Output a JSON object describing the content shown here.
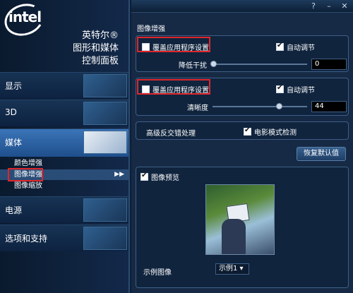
{
  "window": {
    "help_btn": "?",
    "min_btn": "–",
    "close_btn": "✕"
  },
  "brand": {
    "logo": "intel",
    "line1": "英特尔®",
    "line2": "图形和媒体",
    "line3": "控制面板"
  },
  "nav": {
    "display": "显示",
    "threed": "3D",
    "media": "媒体",
    "media_sub": [
      "颜色增强",
      "图像增强",
      "图像缩放"
    ],
    "power": "电源",
    "options": "选项和支持",
    "submenu_arrow": "▶▶"
  },
  "main": {
    "section_title": "图像增强",
    "noise": {
      "override_label": "覆盖应用程序设置",
      "override_checked": false,
      "auto_label": "自动调节",
      "auto_checked": true,
      "slider_label": "降低干扰",
      "value": "0",
      "level": 0
    },
    "sharpness": {
      "override_label": "覆盖应用程序设置",
      "override_checked": false,
      "auto_label": "自动调节",
      "auto_checked": true,
      "slider_label": "清晰度",
      "value": "44",
      "level": 0.7
    },
    "deinterlace_label": "高级反交错处理",
    "film_mode_label": "电影模式检测",
    "film_mode_checked": true,
    "restore_defaults": "恢复默认值",
    "preview_label": "图像预览",
    "preview_checked": true,
    "sample_label": "示例图像",
    "sample_select": "示例1 ▾"
  },
  "colors": {
    "highlight_red": "#e0262a",
    "panel_bg": "#10243e",
    "accent": "#3a74b8"
  }
}
